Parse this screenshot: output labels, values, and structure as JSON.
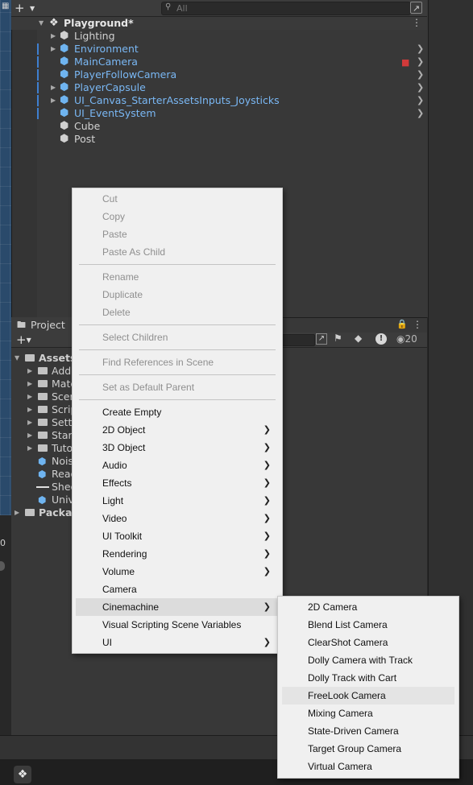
{
  "hierarchy": {
    "search_placeholder": "All",
    "scene_name": "Playground*",
    "items": [
      {
        "label": "Lighting",
        "type": "normal"
      },
      {
        "label": "Environment",
        "type": "prefab"
      },
      {
        "label": "MainCamera",
        "type": "prefab"
      },
      {
        "label": "PlayerFollowCamera",
        "type": "prefab"
      },
      {
        "label": "PlayerCapsule",
        "type": "prefab"
      },
      {
        "label": "UI_Canvas_StarterAssetsInputs_Joysticks",
        "type": "prefab"
      },
      {
        "label": "UI_EventSystem",
        "type": "prefab"
      },
      {
        "label": "Cube",
        "type": "normal"
      },
      {
        "label": "Post",
        "type": "normal"
      }
    ]
  },
  "project": {
    "tab_label": "Project",
    "hidden_count": "20",
    "tree": [
      {
        "label": "Assets"
      },
      {
        "label": "Addi"
      },
      {
        "label": "Mate"
      },
      {
        "label": "Scer"
      },
      {
        "label": "Scrip"
      },
      {
        "label": "Setti"
      },
      {
        "label": "Start"
      },
      {
        "label": "Tuto"
      },
      {
        "label": "Noise"
      },
      {
        "label": "Read"
      },
      {
        "label": "Shee"
      },
      {
        "label": "Univ"
      },
      {
        "label": "Packag"
      }
    ]
  },
  "context_menu": {
    "items": [
      {
        "label": "Cut",
        "enabled": false
      },
      {
        "label": "Copy",
        "enabled": false
      },
      {
        "label": "Paste",
        "enabled": false
      },
      {
        "label": "Paste As Child",
        "enabled": false
      },
      {
        "label": "Rename",
        "enabled": false
      },
      {
        "label": "Duplicate",
        "enabled": false
      },
      {
        "label": "Delete",
        "enabled": false
      },
      {
        "label": "Select Children",
        "enabled": false
      },
      {
        "label": "Find References in Scene",
        "enabled": false
      },
      {
        "label": "Set as Default Parent",
        "enabled": false
      },
      {
        "label": "Create Empty",
        "enabled": true
      },
      {
        "label": "2D Object",
        "enabled": true,
        "submenu": true
      },
      {
        "label": "3D Object",
        "enabled": true,
        "submenu": true
      },
      {
        "label": "Audio",
        "enabled": true,
        "submenu": true
      },
      {
        "label": "Effects",
        "enabled": true,
        "submenu": true
      },
      {
        "label": "Light",
        "enabled": true,
        "submenu": true
      },
      {
        "label": "Video",
        "enabled": true,
        "submenu": true
      },
      {
        "label": "UI Toolkit",
        "enabled": true,
        "submenu": true
      },
      {
        "label": "Rendering",
        "enabled": true,
        "submenu": true
      },
      {
        "label": "Volume",
        "enabled": true,
        "submenu": true
      },
      {
        "label": "Camera",
        "enabled": true
      },
      {
        "label": "Cinemachine",
        "enabled": true,
        "submenu": true,
        "open": true
      },
      {
        "label": "Visual Scripting Scene Variables",
        "enabled": true
      },
      {
        "label": "UI",
        "enabled": true,
        "submenu": true
      }
    ]
  },
  "cinemachine_submenu": {
    "hovered": "FreeLook Camera",
    "items": [
      "2D Camera",
      "Blend List Camera",
      "ClearShot Camera",
      "Dolly Camera with Track",
      "Dolly Track with Cart",
      "FreeLook Camera",
      "Mixing Camera",
      "State-Driven Camera",
      "Target Group Camera",
      "Virtual Camera"
    ]
  },
  "colors": {
    "prefab_text": "#7ab8f5",
    "selection_bar": "#3e7fd0",
    "menu_bg": "#f0f0f0"
  }
}
